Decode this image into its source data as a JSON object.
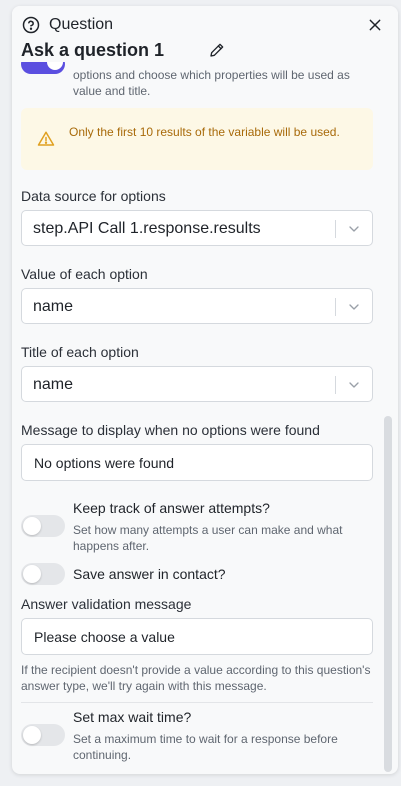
{
  "header": {
    "label": "Question",
    "title": "Ask a question 1"
  },
  "top_description": "options and choose which properties will be used as value and title.",
  "warning": "Only the first 10 results of the variable will be used.",
  "data_source": {
    "label": "Data source for options",
    "value": "step.API Call 1.response.results"
  },
  "value_option": {
    "label": "Value of each option",
    "value": "name"
  },
  "title_option": {
    "label": "Title of each option",
    "value": "name"
  },
  "no_options": {
    "label": "Message to display when no options were found",
    "value": "No options were found"
  },
  "answer_attempts": {
    "title": "Keep track of answer attempts?",
    "description": "Set how many attempts a user can make and what happens after."
  },
  "save_answer": {
    "title": "Save answer in contact?"
  },
  "validation": {
    "label": "Answer validation message",
    "value": "Please choose a value",
    "help": "If the recipient doesn't provide a value according to this question's answer type, we'll try again with this message."
  },
  "max_wait": {
    "title": "Set max wait time?",
    "description": "Set a maximum time to wait for a response before continuing."
  },
  "colors": {
    "accent": "#5b4fe0",
    "warning_bg": "#fdf8e6",
    "warning_text": "#a86a0a"
  },
  "icons": [
    "question-circle-icon",
    "close-icon",
    "pencil-icon",
    "warning-triangle-icon",
    "chevron-down-icon"
  ]
}
